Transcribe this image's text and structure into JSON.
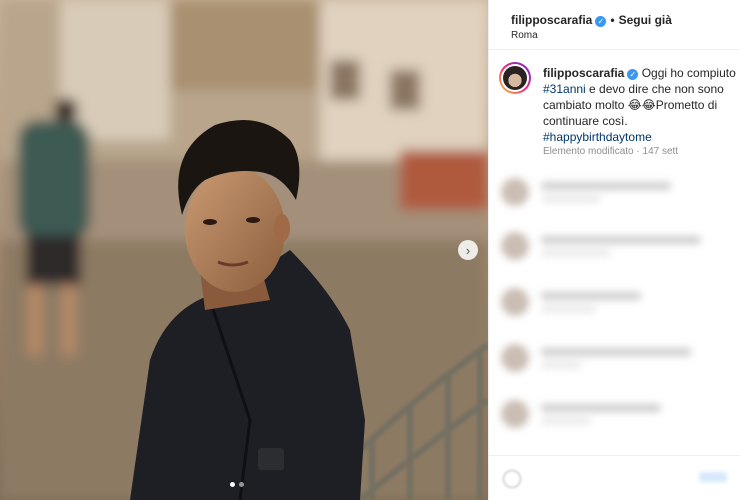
{
  "post": {
    "username": "filipposcarafia",
    "follow_status": "Segui già",
    "separator": "•",
    "location": "Roma",
    "caption": {
      "username": "filipposcarafia",
      "text_before": " Oggi ho compiuto ",
      "hashtag_age": "#31anni",
      "text_middle": " e devo dire che non sono cambiato molto 😂😂Prometto di continuare così.",
      "hashtag_birthday": "#happybirthdaytome",
      "edited_label": "Elemento modificato",
      "meta_sep": "·",
      "age": "147 sett"
    },
    "carousel": {
      "current": 1,
      "total": 2,
      "next_glyph": "›"
    },
    "verified_glyph": "✓"
  },
  "colors": {
    "accent": "#3897f0",
    "hashtag": "#00376b",
    "meta": "#8e8e8e"
  },
  "icons": [
    "verified-badge-icon",
    "chevron-right-icon",
    "emoji-icon"
  ]
}
